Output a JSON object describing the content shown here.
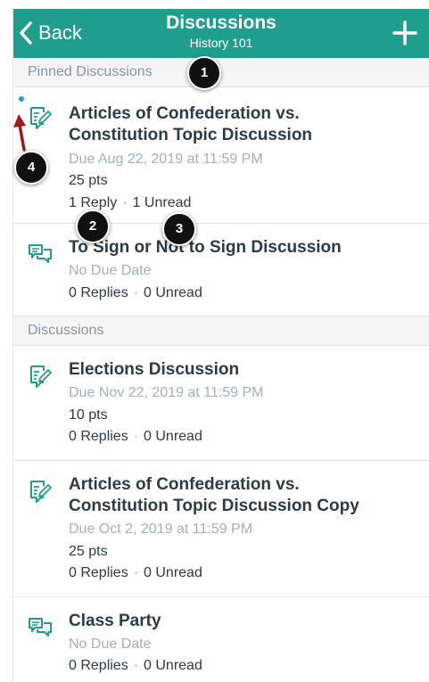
{
  "navbar": {
    "back_label": "Back",
    "title": "Discussions",
    "subtitle": "History 101",
    "back_icon": "chevron-left-icon",
    "add_icon": "plus-icon"
  },
  "sections": {
    "pinned_label": "Pinned Discussions",
    "discussions_label": "Discussions"
  },
  "pinned": [
    {
      "title_line1": "Articles of Confederation vs.",
      "title_line2": "Constitution Topic Discussion",
      "due": "Due Aug 22, 2019 at 11:59 PM",
      "points": "25 pts",
      "replies": "1 Reply",
      "unread": "1 Unread",
      "icon": "assignment-discussion-icon"
    },
    {
      "title_line1": "To Sign or Not to Sign Discussion",
      "due": "No Due Date",
      "replies": "0 Replies",
      "unread": "0 Unread",
      "icon": "discussion-icon"
    }
  ],
  "discussions": [
    {
      "title_line1": "Elections Discussion",
      "due": "Due Nov 22, 2019 at 11:59 PM",
      "points": "10 pts",
      "replies": "0 Replies",
      "unread": "0 Unread",
      "icon": "assignment-discussion-icon"
    },
    {
      "title_line1": "Articles of Confederation vs.",
      "title_line2": "Constitution Topic Discussion Copy",
      "due": "Due Oct 2, 2019 at 11:59 PM",
      "points": "25 pts",
      "replies": "0 Replies",
      "unread": "0 Unread",
      "icon": "assignment-discussion-icon"
    },
    {
      "title_line1": "Class Party",
      "due": "No Due Date",
      "replies": "0 Replies",
      "unread": "0 Unread",
      "icon": "discussion-icon"
    }
  ],
  "callouts": [
    "1",
    "2",
    "3",
    "4"
  ],
  "colors": {
    "brand": "#1f9e8e",
    "unread_dot": "#2a9cd8",
    "arrow": "#9b1b1b"
  },
  "separator": "·"
}
